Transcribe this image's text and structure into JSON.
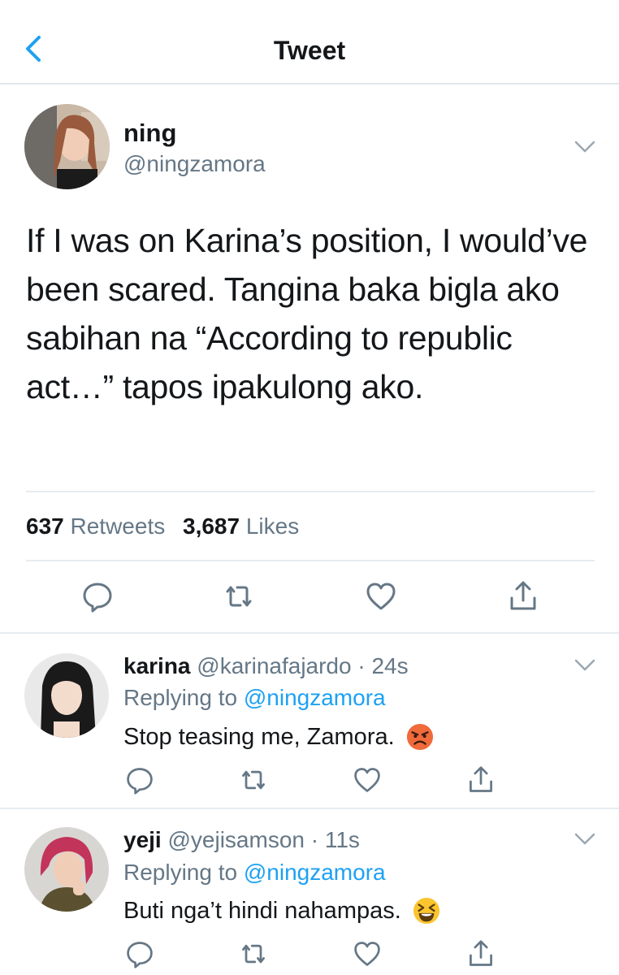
{
  "nav": {
    "title": "Tweet"
  },
  "tweet": {
    "name": "ning",
    "handle": "@ningzamora",
    "lines": [
      "If I was on Karina’s position, I would’ve",
      "been scared. Tangina baka bigla ako",
      "sabihan na “According to republic",
      "act…” tapos ipakulong ako."
    ],
    "retweets": "637",
    "retweets_label": "Retweets",
    "likes": "3,687",
    "likes_label": "Likes"
  },
  "replies": [
    {
      "name": "karina",
      "handle": "@karinafajardo",
      "time": "· 24s",
      "replying_prefix": "Replying to",
      "replying_to": "@ningzamora",
      "text": "Stop teasing me, Zamora.",
      "emoji": "angry-face-emoji"
    },
    {
      "name": "yeji",
      "handle": "@yejisamson",
      "time": "· 11s",
      "replying_prefix": "Replying to",
      "replying_to": "@ningzamora",
      "text": "Buti nga’t hindi nahampas.",
      "emoji": "laughing-face-emoji"
    }
  ],
  "colors": {
    "accent": "#1da1f2",
    "muted": "#657786",
    "text": "#14171a",
    "divider": "#e6ecf0"
  }
}
